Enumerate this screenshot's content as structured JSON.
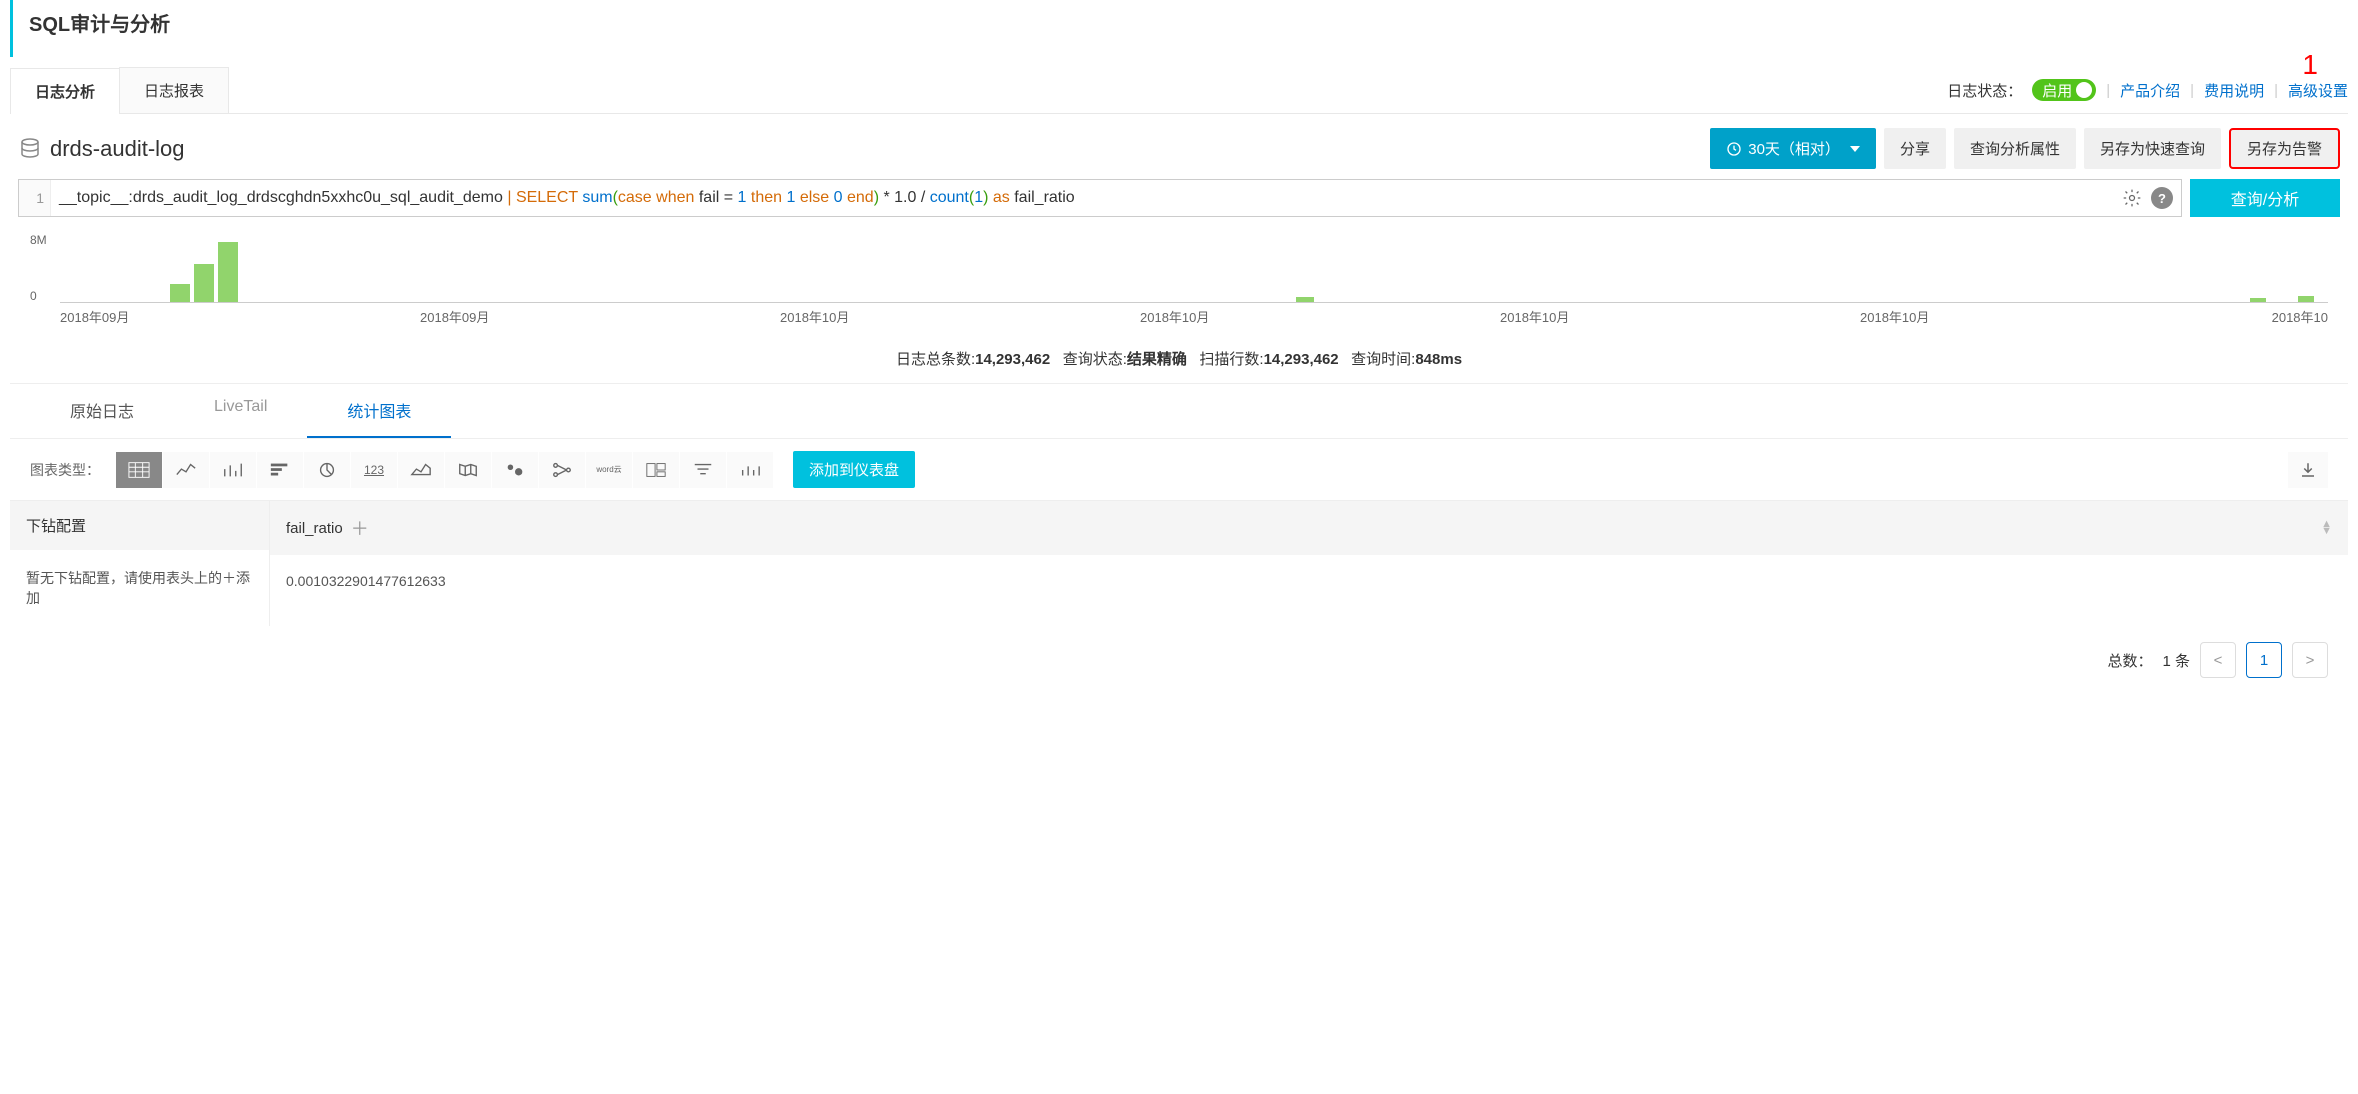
{
  "page_title": "SQL审计与分析",
  "tabs": {
    "log_analysis": "日志分析",
    "log_report": "日志报表"
  },
  "top_right": {
    "status_label": "日志状态：",
    "toggle_text": "启用",
    "product_intro": "产品介绍",
    "cost_desc": "费用说明",
    "advanced": "高级设置",
    "annotation": "1"
  },
  "log_name": "drds-audit-log",
  "toolbar": {
    "time_range": "30天（相对）",
    "share": "分享",
    "query_attr": "查询分析属性",
    "save_quick": "另存为快速查询",
    "save_alert": "另存为告警"
  },
  "query": {
    "line_no": "1",
    "prefix": "__topic__:drds_audit_log_drdscghdn5xxhc0u_sql_audit_demo",
    "pipe": " | ",
    "select": "SELECT ",
    "sum": "sum",
    "p1": "(",
    "case": "case when",
    "cond": " fail = ",
    "n1": "1",
    "then": " then ",
    "n1b": "1",
    "else": " else ",
    "n0": "0",
    "end": " end",
    "p2": ") ",
    "mul": "* 1.0 / ",
    "count": "count",
    "p3": "(",
    "n1c": "1",
    "p4": ") ",
    "as": "as",
    "alias": " fail_ratio",
    "run": "查询/分析"
  },
  "histogram": {
    "ymax": "8M",
    "ymin": "0",
    "xticks": [
      "2018年09月",
      "2018年09月",
      "2018年10月",
      "2018年10月",
      "2018年10月",
      "2018年10月",
      "2018年10"
    ]
  },
  "stats": {
    "total_label": "日志总条数:",
    "total_value": "14,293,462",
    "status_label": "查询状态:",
    "status_value": "结果精确",
    "scan_label": "扫描行数:",
    "scan_value": "14,293,462",
    "time_label": "查询时间:",
    "time_value": "848ms"
  },
  "subtabs": {
    "raw": "原始日志",
    "livetail": "LiveTail",
    "chart": "统计图表"
  },
  "chart_type_label": "图表类型：",
  "add_dashboard": "添加到仪表盘",
  "result": {
    "drill_header": "下钻配置",
    "drill_empty": "暂无下钻配置，请使用表头上的＋添加",
    "col_name": "fail_ratio",
    "value": "0.0010322901477612633"
  },
  "pager": {
    "total_label": "总数：",
    "total_value": "1 条",
    "page": "1"
  }
}
